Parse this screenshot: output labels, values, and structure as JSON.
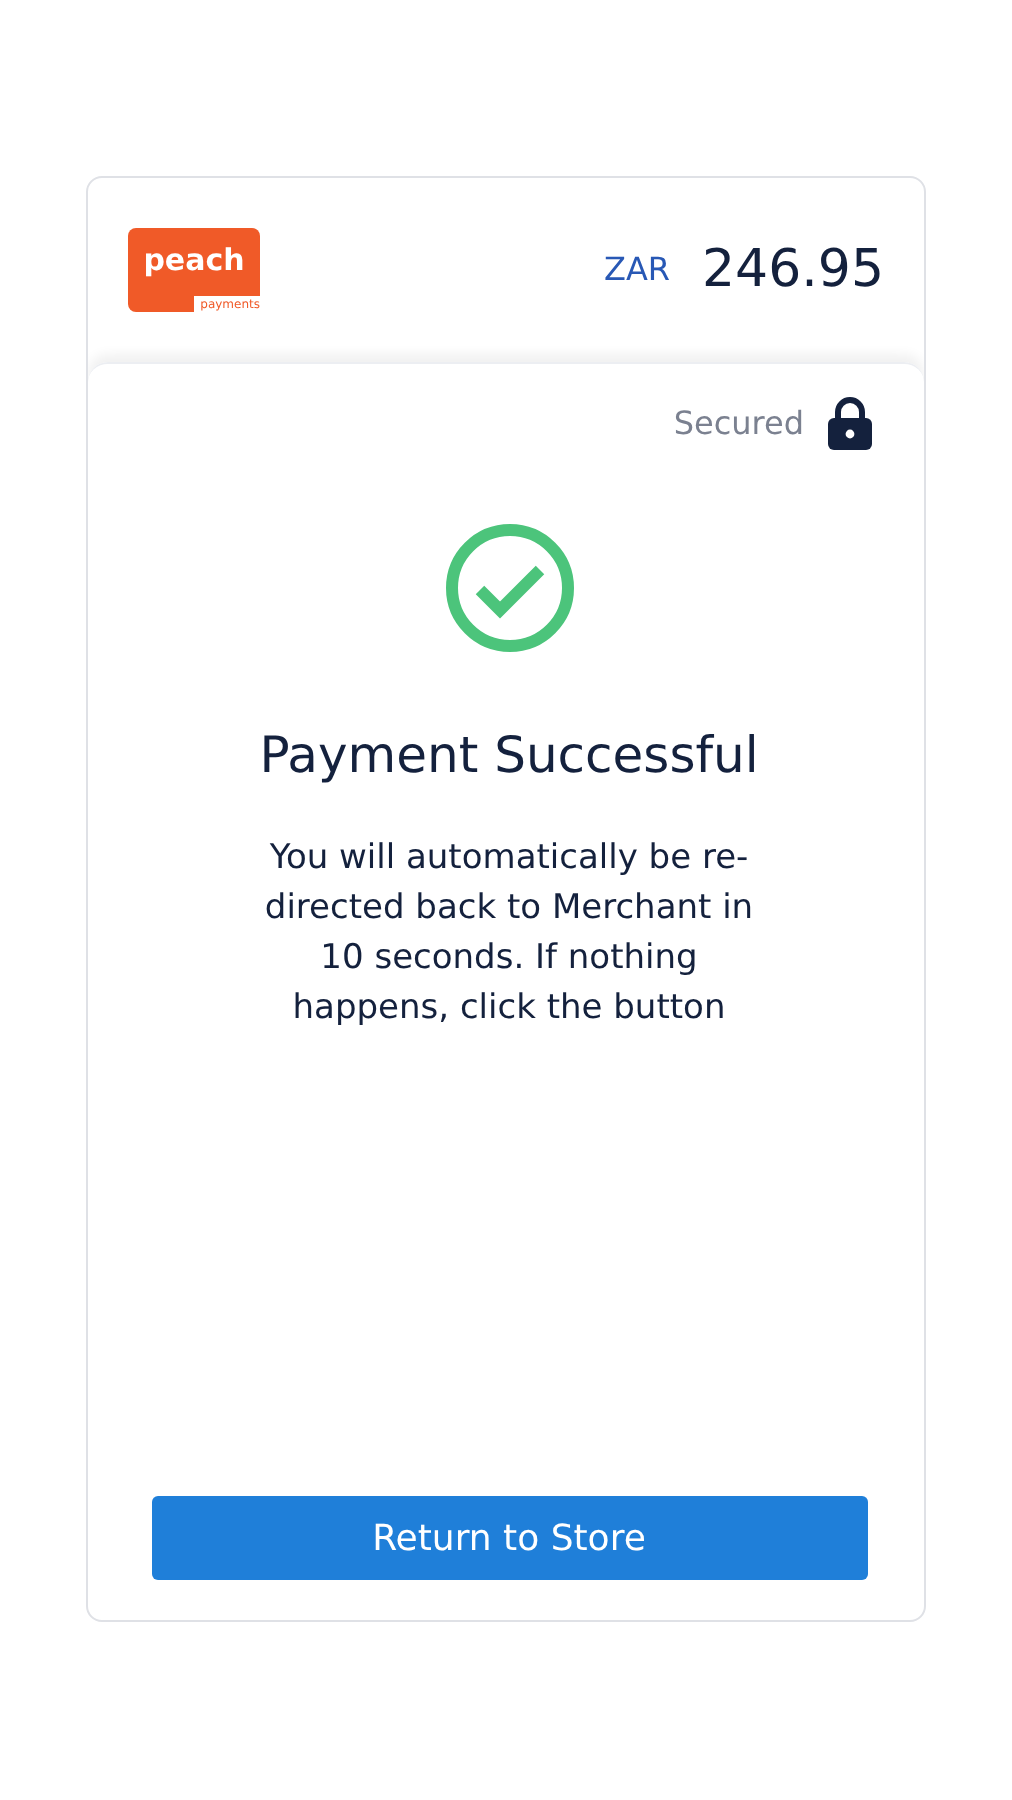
{
  "logo": {
    "name": "peach",
    "tagline": "payments"
  },
  "amount": {
    "currency": "ZAR",
    "value": "246.95"
  },
  "security": {
    "label": "Secured"
  },
  "status": {
    "title": "Payment Successful",
    "message": "You will automatically be re-directed back to Merchant in 10 seconds. If nothing happens, click the button"
  },
  "button": {
    "label": "Return to Store"
  }
}
